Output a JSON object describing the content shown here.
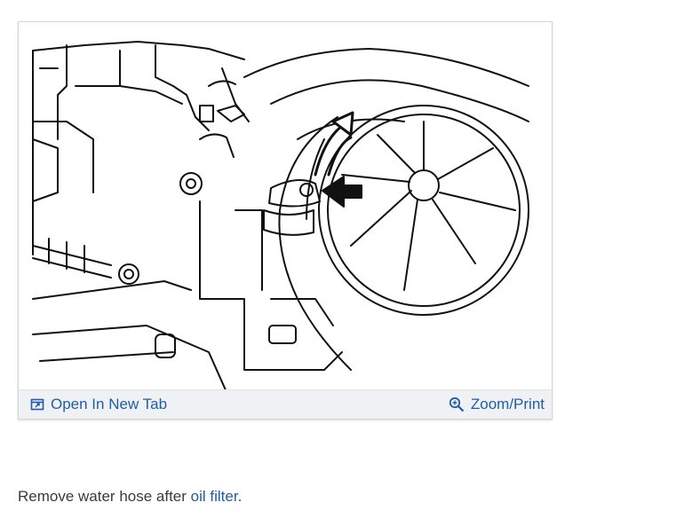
{
  "figure": {
    "open_tab_label": "Open In New Tab",
    "zoom_label": "Zoom/Print",
    "icons": {
      "open_tab": "open-in-new-tab-icon",
      "zoom": "magnifier-zoom-icon"
    },
    "image_kind": "line drawing"
  },
  "caption": {
    "prefix": "Remove water hose after ",
    "link_text": "oil filter",
    "suffix": "."
  },
  "colors": {
    "link": "#1f5da8",
    "toolbar_bg": "#f0f1f4",
    "text": "#3a3a3a"
  }
}
